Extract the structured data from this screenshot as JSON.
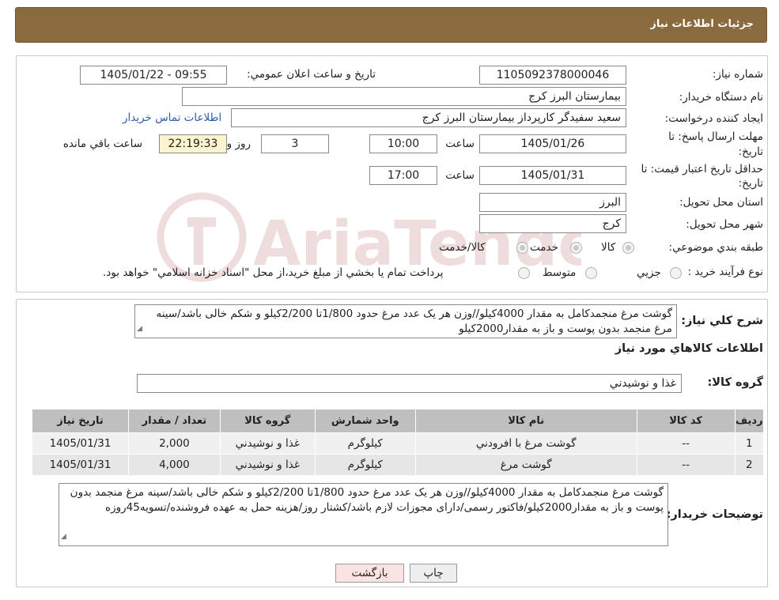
{
  "header": {
    "title": "جزئيات اطلاعات نياز"
  },
  "form": {
    "need_number_label": "شماره نياز:",
    "need_number": "1105092378000046",
    "announce_label": "تاريخ و ساعت اعلان عمومي:",
    "announce_value": "1405/01/22 - 09:55",
    "buyer_label": "نام دستگاه خريدار:",
    "buyer_value": "بيمارستان البرز کرج",
    "creator_label": "ايجاد کننده درخواست:",
    "creator_value": "سعيد سفيدگر کارپرداز بيمارستان البرز کرج",
    "contact_link": "اطلاعات تماس خريدار",
    "deadline_label_1": "مهلت ارسال پاسخ: تا",
    "deadline_label_2": "تاريخ:",
    "deadline_date": "1405/01/26",
    "time_label": "ساعت",
    "deadline_time": "10:00",
    "days_value": "3",
    "days_label": "روز و",
    "remaining_time": "22:19:33",
    "remaining_label": "ساعت باقي مانده",
    "validity_label_1": "حداقل تاريخ اعتبار قيمت: تا",
    "validity_label_2": "تاريخ:",
    "validity_date": "1405/01/31",
    "validity_time": "17:00",
    "province_label": "استان محل تحويل:",
    "province_value": "البرز",
    "city_label": "شهر محل تحويل:",
    "city_value": "کرج",
    "category_label": "طبقه بندي موضوعي:",
    "category_options": [
      "کالا",
      "خدمت",
      "کالا/خدمت"
    ],
    "process_label": "نوع فرآيند خريد :",
    "process_options": [
      "جزيي",
      "متوسط"
    ],
    "process_note": "پرداخت تمام يا بخشي از مبلغ خريد،از محل \"اسناد خزانه اسلامي\" خواهد بود."
  },
  "summary": {
    "label": "شرح کلي نياز:",
    "text": "گوشت مرغ منجمدکامل به مقدار 4000کیلو//وزن هر یک عدد مرغ حدود 1/800تا 2/200کیلو و شکم خالی باشد/سینه مرغ منجمد بدون پوست و باز به مقدار2000کیلو"
  },
  "goods": {
    "section_title": "اطلاعات کالاهاي مورد نياز",
    "group_label": "گروه کالا:",
    "group_value": "غذا و نوشيدني",
    "columns": [
      "رديف",
      "کد کالا",
      "نام کالا",
      "واحد شمارش",
      "گروه کالا",
      "تعداد / مقدار",
      "تاريخ نياز"
    ],
    "rows": [
      [
        "1",
        "--",
        "گوشت مرغ با افرودني",
        "کيلوگرم",
        "غذا و نوشيدني",
        "2,000",
        "1405/01/31"
      ],
      [
        "2",
        "--",
        "گوشت مرغ",
        "کيلوگرم",
        "غذا و نوشيدني",
        "4,000",
        "1405/01/31"
      ]
    ]
  },
  "buyer_notes": {
    "label": "توضيحات خريدار:",
    "text": "گوشت مرغ منجمدکامل به مقدار 4000کیلو//وزن هر یک عدد مرغ حدود 1/800تا 2/200کیلو و شکم خالی باشد/سینه مرغ منجمد بدون پوست و باز به مقدار2000کیلو/فاکتور رسمی/دارای مجوزات لازم باشد/کشتار روز/هزینه حمل به عهده فروشنده/تسویه45روزه"
  },
  "buttons": {
    "print": "چاپ",
    "back": "بازگشت"
  },
  "watermark": "AriaTender.neT",
  "colors": {
    "header_bg": "#8a6a3f",
    "link": "#2a5db0",
    "remaining_bg": "#fbf4cf",
    "back_button_bg": "#fbe3e3"
  }
}
